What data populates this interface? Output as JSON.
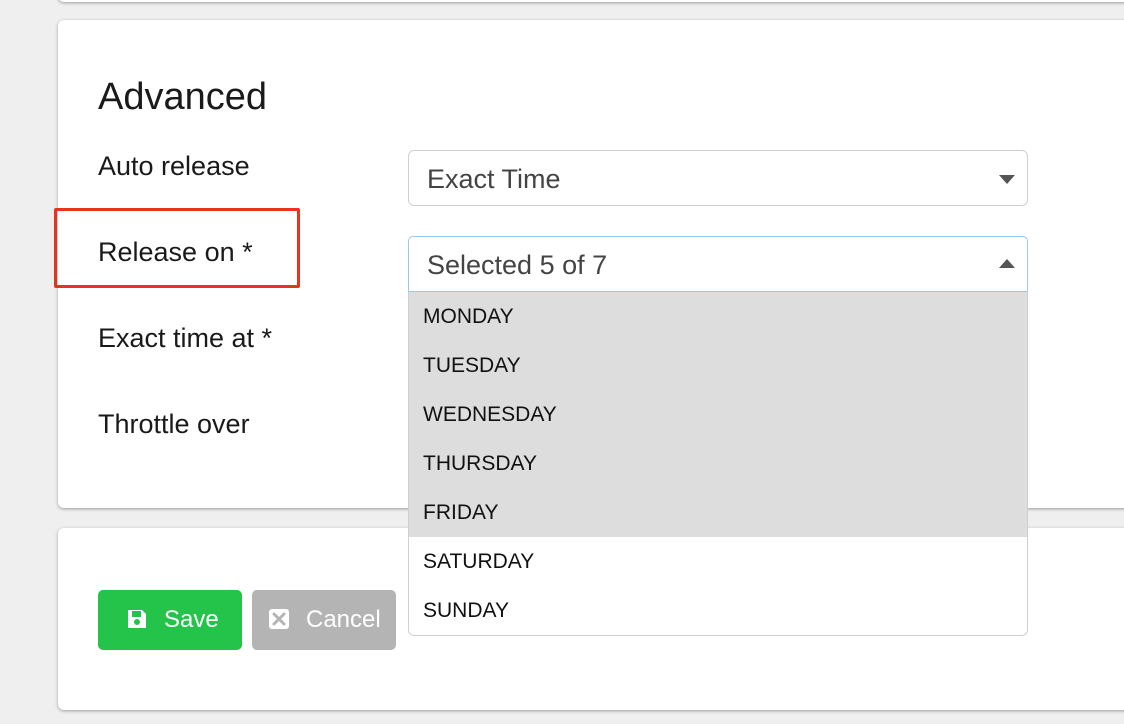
{
  "section": {
    "title": "Advanced"
  },
  "fields": {
    "auto_release": {
      "label": "Auto release",
      "value": "Exact Time"
    },
    "release_on": {
      "label": "Release on *",
      "value": "Selected 5 of 7",
      "options": [
        {
          "label": "MONDAY",
          "selected": true
        },
        {
          "label": "TUESDAY",
          "selected": true
        },
        {
          "label": "WEDNESDAY",
          "selected": true
        },
        {
          "label": "THURSDAY",
          "selected": true
        },
        {
          "label": "FRIDAY",
          "selected": true
        },
        {
          "label": "SATURDAY",
          "selected": false
        },
        {
          "label": "SUNDAY",
          "selected": false
        }
      ]
    },
    "exact_time": {
      "label": "Exact time at *"
    },
    "throttle": {
      "label": "Throttle over"
    }
  },
  "actions": {
    "save_label": "Save",
    "cancel_label": "Cancel",
    "save_icon": "floppy-disk-icon",
    "cancel_icon": "close-box-icon"
  },
  "colors": {
    "save_bg": "#24c34a",
    "cancel_bg": "#b4b4b4",
    "highlight": "#e8341f",
    "selected_option_bg": "#dddddd",
    "focus_border": "#9ec9ee"
  }
}
